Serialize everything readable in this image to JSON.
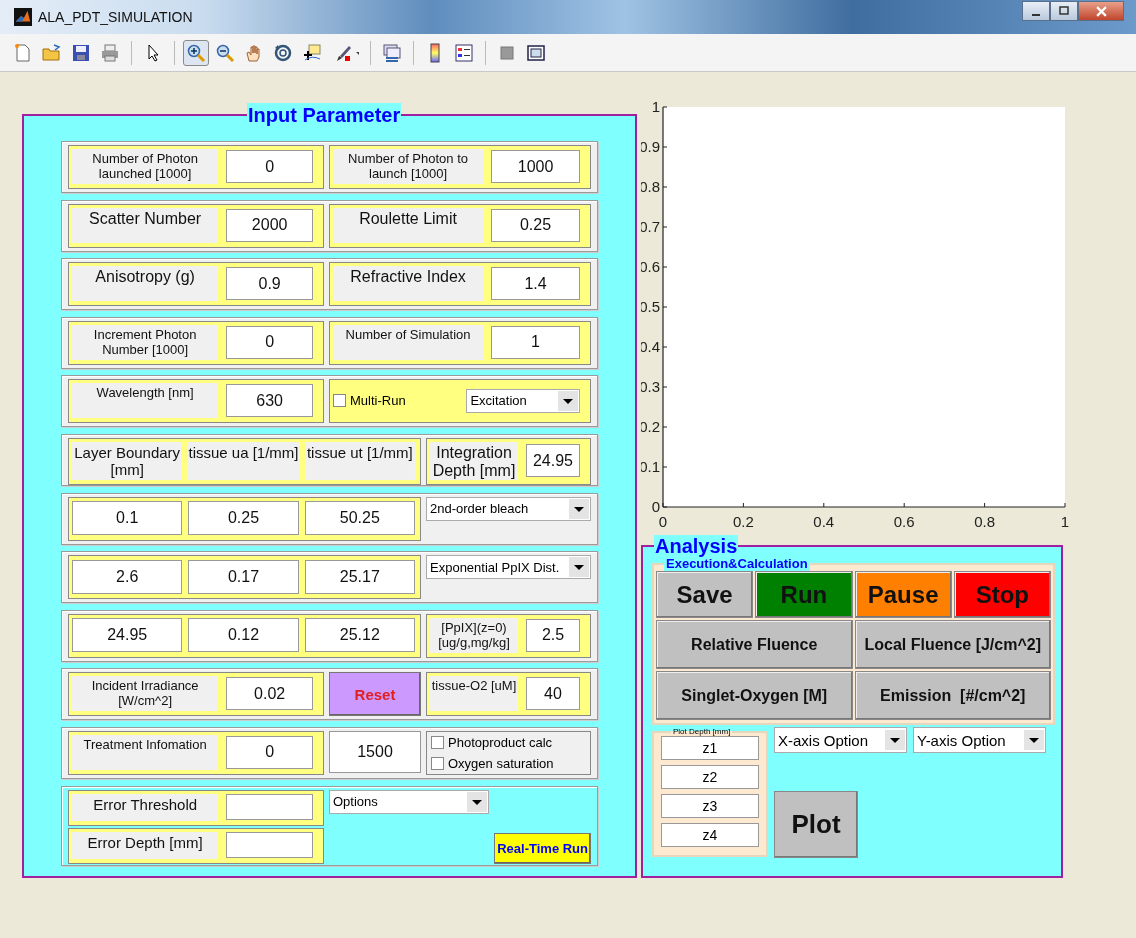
{
  "window": {
    "title": "ALA_PDT_SIMULATION"
  },
  "toolbar": {
    "groups": [
      {
        "tools": [
          {
            "selected": false
          },
          {
            "selected": false
          },
          {
            "selected": false
          },
          {
            "selected": false
          }
        ]
      },
      {
        "tools": [
          {
            "selected": false
          }
        ]
      },
      {
        "tools": [
          {
            "selected": true
          },
          {
            "selected": false
          },
          {
            "selected": false
          },
          {
            "selected": false
          },
          {
            "selected": false
          },
          {
            "selected": false
          }
        ]
      },
      {
        "tools": [
          {
            "selected": false
          }
        ]
      },
      {
        "tools": [
          {
            "selected": false
          },
          {
            "selected": false
          }
        ]
      },
      {
        "tools": [
          {
            "selected": false
          },
          {
            "selected": false
          }
        ]
      }
    ]
  },
  "input_parameter": {
    "title": "Input Parameter",
    "rows": [
      {
        "kind": "grid",
        "groups": [
          {
            "kind": "framed",
            "items": [
              {
                "kind": "label",
                "text": "Number of Photon launched [1000]"
              },
              {
                "kind": "input",
                "value": "0"
              }
            ]
          },
          {
            "kind": "framed",
            "items": [
              {
                "kind": "label",
                "text": "Number of Photon to launch [1000]"
              },
              {
                "kind": "input",
                "value": "1000"
              }
            ]
          }
        ]
      },
      {
        "kind": "grid",
        "groups": [
          {
            "kind": "framed",
            "items": [
              {
                "kind": "label",
                "text": "Scatter Number"
              },
              {
                "kind": "input",
                "value": "2000"
              }
            ]
          },
          {
            "kind": "framed",
            "items": [
              {
                "kind": "label",
                "text": "Roulette Limit"
              },
              {
                "kind": "input",
                "value": "0.25"
              }
            ]
          }
        ]
      },
      {
        "kind": "grid",
        "groups": [
          {
            "kind": "framed",
            "items": [
              {
                "kind": "label",
                "text": "Anisotropy (g)"
              },
              {
                "kind": "input",
                "value": "0.9"
              }
            ]
          },
          {
            "kind": "framed",
            "items": [
              {
                "kind": "label",
                "text": "Refractive Index"
              },
              {
                "kind": "input",
                "value": "1.4"
              }
            ]
          }
        ]
      },
      {
        "kind": "grid",
        "groups": [
          {
            "kind": "framed",
            "items": [
              {
                "kind": "label",
                "text": "Increment Photon Number [1000]"
              },
              {
                "kind": "input",
                "value": "0"
              }
            ]
          },
          {
            "kind": "framed",
            "items": [
              {
                "kind": "label",
                "text": "Number of Simulation"
              },
              {
                "kind": "input",
                "value": "1"
              }
            ]
          }
        ]
      },
      {
        "kind": "grid",
        "groups": [
          {
            "kind": "framed",
            "items": [
              {
                "kind": "label",
                "text": "Wavelength [nm]"
              },
              {
                "kind": "input",
                "value": "630"
              }
            ]
          },
          {
            "kind": "framed",
            "items": [
              {
                "kind": "checkbox",
                "text": "Multi-Run",
                "checked": false
              },
              {
                "kind": "dropdown",
                "value": "Excitation"
              }
            ]
          }
        ]
      },
      {
        "kind": "grid",
        "groups": [
          {
            "kind": "framed",
            "items": [
              {
                "kind": "label",
                "text": "Layer Boundary [mm]"
              },
              {
                "kind": "label",
                "text": "tissue ua [1/mm]"
              },
              {
                "kind": "label",
                "text": "tissue ut [1/mm]"
              }
            ]
          },
          {
            "kind": "framed",
            "items": [
              {
                "kind": "label",
                "text": "Integration Depth [mm]"
              },
              {
                "kind": "input",
                "value": "24.95"
              }
            ]
          }
        ]
      },
      {
        "kind": "grid",
        "groups": [
          {
            "kind": "framed",
            "items": [
              {
                "kind": "input",
                "value": "0.1"
              },
              {
                "kind": "input",
                "value": "0.25"
              },
              {
                "kind": "input",
                "value": "50.25"
              }
            ]
          },
          {
            "kind": "plain",
            "items": [
              {
                "kind": "dropdown",
                "value": "2nd-order bleach"
              }
            ]
          }
        ]
      },
      {
        "kind": "grid",
        "groups": [
          {
            "kind": "framed",
            "items": [
              {
                "kind": "input",
                "value": "2.6"
              },
              {
                "kind": "input",
                "value": "0.17"
              },
              {
                "kind": "input",
                "value": "25.17"
              }
            ]
          },
          {
            "kind": "plain",
            "items": [
              {
                "kind": "dropdown",
                "value": "Exponential PpIX Dist."
              }
            ]
          }
        ]
      },
      {
        "kind": "grid",
        "groups": [
          {
            "kind": "framed",
            "items": [
              {
                "kind": "input",
                "value": "24.95"
              },
              {
                "kind": "input",
                "value": "0.12"
              },
              {
                "kind": "input",
                "value": "25.12"
              }
            ]
          },
          {
            "kind": "framed",
            "items": [
              {
                "kind": "label",
                "text": "[PpIX](z=0) [ug/g,mg/kg]"
              },
              {
                "kind": "input",
                "value": "2.5"
              }
            ]
          }
        ]
      },
      {
        "kind": "grid",
        "groups": [
          {
            "kind": "framed",
            "items": [
              {
                "kind": "label",
                "text": "Incident Irradiance [W/cm^2]"
              },
              {
                "kind": "input",
                "value": "0.02"
              }
            ]
          },
          {
            "kind": "plain",
            "items": [
              {
                "kind": "button",
                "text": "Reset",
                "color": "#cc99ff"
              }
            ]
          },
          {
            "kind": "framed",
            "items": [
              {
                "kind": "label",
                "text": "tissue-O2 [uM]"
              },
              {
                "kind": "input",
                "value": "40"
              }
            ]
          }
        ]
      },
      {
        "kind": "grid",
        "groups": [
          {
            "kind": "framed",
            "items": [
              {
                "kind": "label",
                "text": "Treatment Infomation"
              },
              {
                "kind": "input",
                "value": "0"
              }
            ]
          },
          {
            "kind": "plain",
            "items": [
              {
                "kind": "input",
                "value": "1500"
              }
            ]
          },
          {
            "kind": "framed",
            "items": [
              {
                "kind": "checkbox",
                "text": "Photoproduct calc",
                "checked": false
              },
              {
                "kind": "checkbox",
                "text": "Oxygen saturation",
                "checked": false
              }
            ]
          }
        ]
      },
      {
        "kind": "split",
        "groups": [
          {
            "kind": "framed",
            "items": [
              {
                "kind": "label",
                "text": "Error Threshold"
              },
              {
                "kind": "input"
              }
            ]
          },
          {
            "kind": "framed",
            "items": [
              {
                "kind": "label",
                "text": "Error Depth [mm]"
              },
              {
                "kind": "input"
              }
            ]
          },
          {
            "kind": "plain",
            "items": [
              {
                "kind": "dropdown",
                "value": "Options"
              }
            ]
          },
          {
            "kind": "plain",
            "items": [
              {
                "kind": "button",
                "text": "Real-Time Run",
                "color": "#ffff00"
              }
            ]
          }
        ]
      }
    ]
  },
  "chart_data": {
    "type": "line",
    "xlim": [
      0,
      1
    ],
    "ylim": [
      0,
      1
    ],
    "xticks": [
      0,
      0.2,
      0.4,
      0.6,
      0.8,
      1
    ],
    "yticks": [
      0,
      0.1,
      0.2,
      0.3,
      0.4,
      0.5,
      0.6,
      0.7,
      0.8,
      0.9,
      1
    ]
  },
  "analysis": {
    "title": "Analysis",
    "execution": {
      "title": "Execution&Calculation",
      "buttons": [
        {
          "label": "Save",
          "color": "#c0c0c0"
        },
        {
          "label": "Run",
          "color": "#008000"
        },
        {
          "label": "Pause",
          "color": "#ff8000"
        },
        {
          "label": "Stop",
          "color": "#ff0000"
        },
        {
          "label": "Relative Fluence",
          "color": "#c0c0c0"
        },
        {
          "label": "Local Fluence [J/cm^2]",
          "color": "#c0c0c0"
        },
        {
          "label": "Singlet-Oxygen [M]",
          "color": "#c0c0c0"
        },
        {
          "label": "Emission  [#/cm^2]",
          "color": "#c0c0c0"
        }
      ]
    },
    "plot_depth": {
      "title": "Plot Depth [mm]",
      "fields": [
        {
          "value": "z1"
        },
        {
          "value": "z2"
        },
        {
          "value": "z3"
        },
        {
          "value": "z4"
        }
      ]
    },
    "dropdowns": [
      {
        "value": "X-axis Option"
      },
      {
        "value": "Y-axis Option"
      }
    ],
    "plot_button": {
      "label": "Plot"
    }
  }
}
